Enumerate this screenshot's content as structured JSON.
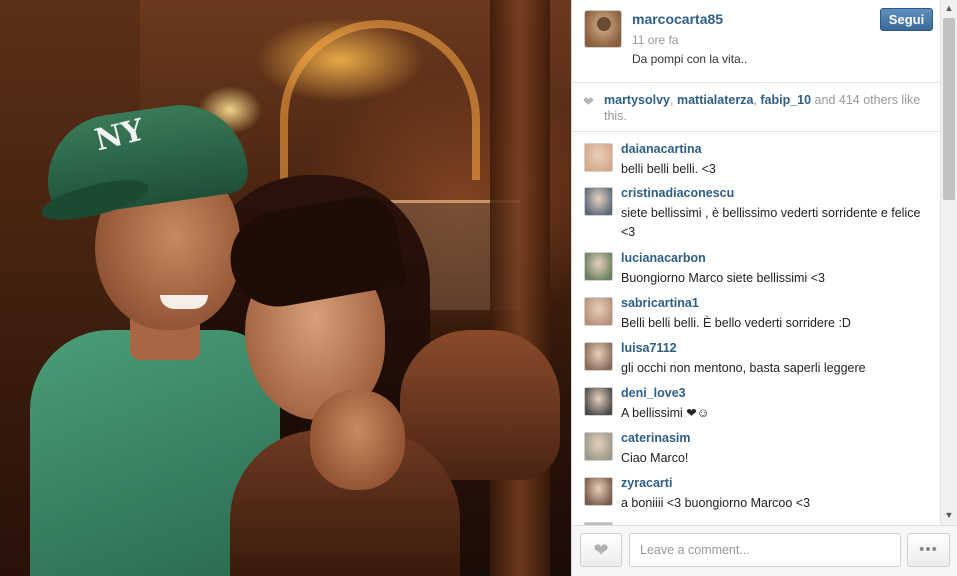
{
  "post": {
    "owner": "marcocarta85",
    "time_ago": "11 ore fa",
    "caption": "Da pompi con la vita..",
    "follow_label": "Segui",
    "photo_logo": "NY"
  },
  "likes": {
    "users": [
      "martysolvy",
      "mattialaterza",
      "fabip_10"
    ],
    "sep1": ", ",
    "sep2": ", ",
    "and_text": " and 414 others like this."
  },
  "comments": [
    {
      "user": "daianacartina",
      "text": "belli belli belli. <3",
      "avatar_color": "#d7a98a"
    },
    {
      "user": "cristinadiaconescu",
      "text": "siete bellissimi , è bellissimo vederti sorridente e felice <3",
      "avatar_color": "#5a6a7a"
    },
    {
      "user": "lucianacarbon",
      "text": "Buongiorno Marco siete bellissimi <3",
      "avatar_color": "#6a8060"
    },
    {
      "user": "sabricartina1",
      "text": "Belli belli belli. È bello vederti sorridere :D",
      "avatar_color": "#b89078"
    },
    {
      "user": "luisa7112",
      "text": "gli occhi non mentono, basta saperli leggere",
      "avatar_color": "#8a6a5a"
    },
    {
      "user": "deni_love3",
      "text": "A bellissimi ❤☺",
      "avatar_color": "#4a4a4a"
    },
    {
      "user": "caterinasim",
      "text": "Ciao Marco!",
      "avatar_color": "#9a9a8a"
    },
    {
      "user": "zyracarti",
      "text": "a boniiii <3 buongiorno Marcoo <3",
      "avatar_color": "#7a5a4a"
    }
  ],
  "comment_bar": {
    "placeholder": "Leave a comment...",
    "like_icon": "heart-icon",
    "more_label": "•••"
  },
  "scrollbar": {
    "up_glyph": "▲",
    "down_glyph": "▼"
  },
  "colors": {
    "link_blue": "#2e5e86",
    "follow_button": "#4a7aab",
    "muted_text": "#999999"
  }
}
